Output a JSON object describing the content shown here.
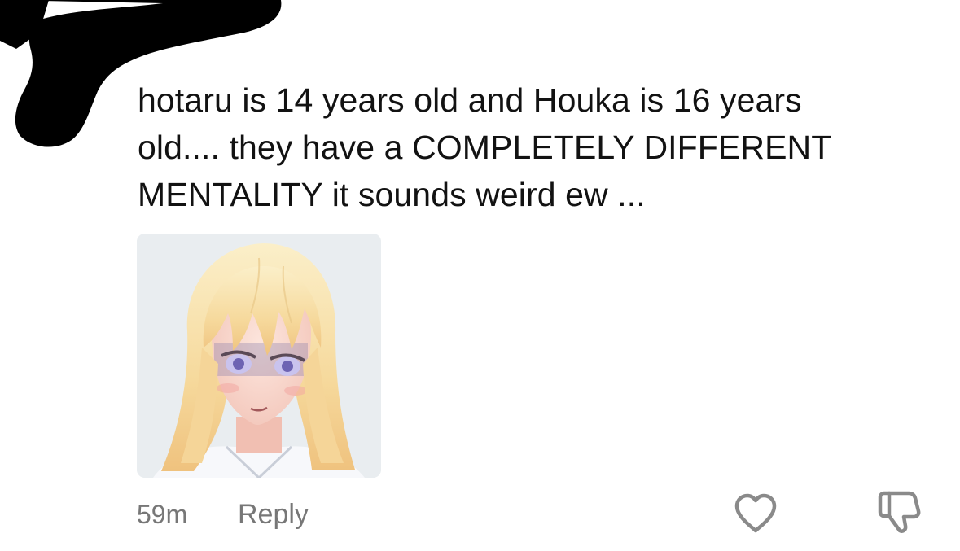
{
  "comment": {
    "lines": [
      "hotaru is 14 years old and Houka is 16 years",
      "old.... they have a COMPLETELY DIFFERENT",
      "MENTALITY it sounds weird ew ..."
    ]
  },
  "sticker": {
    "icon": "anime-girl-sticker"
  },
  "footer": {
    "timestamp": "59m",
    "reply_label": "Reply"
  },
  "icons": {
    "redaction": "redaction-blob",
    "like": "heart-outline-icon",
    "dislike": "thumbs-down-outline-icon"
  },
  "colors": {
    "text": "#121212",
    "muted": "#777777",
    "icon": "#8a8a8a",
    "redaction": "#000000"
  }
}
